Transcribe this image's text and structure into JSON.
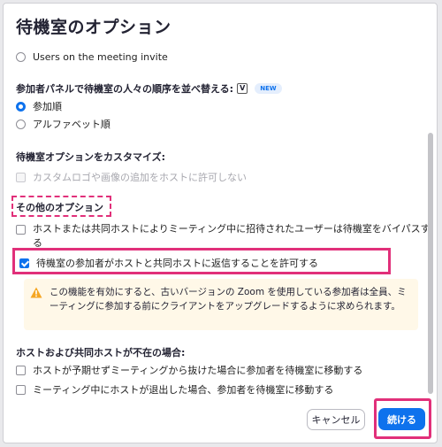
{
  "dialog": {
    "title": "待機室のオプション"
  },
  "who_goes_in": {
    "options": [
      {
        "label": "Users on the meeting invite",
        "checked": false
      }
    ]
  },
  "ordering": {
    "heading": "参加者パネルで待機室の人々の順序を並べ替える:",
    "kbd_icon": "V",
    "new_badge": "NEW",
    "options": [
      {
        "label": "参加順",
        "checked": true
      },
      {
        "label": "アルファベット順",
        "checked": false
      }
    ]
  },
  "customize": {
    "heading": "待機室オプションをカスタマイズ:",
    "options": [
      {
        "label": "カスタムロゴや画像の追加をホストに許可しない",
        "checked": false,
        "disabled": true
      }
    ]
  },
  "other": {
    "heading": "その他のオプション",
    "options": [
      {
        "label": "ホストまたは共同ホストによりミーティング中に招待されたユーザーは待機室をバイパスする",
        "checked": false
      },
      {
        "label": "待機室の参加者がホストと共同ホストに返信することを許可する",
        "checked": true
      }
    ],
    "warning": "この機能を有効にすると、古いバージョンの Zoom を使用している参加者は全員、ミーティングに参加する前にクライアントをアップグレードするように求められます。"
  },
  "absent": {
    "heading": "ホストおよび共同ホストが不在の場合:",
    "options": [
      {
        "label": "ホストが予期せずミーティングから抜けた場合に参加者を待機室に移動する",
        "checked": false
      },
      {
        "label": "ミーティング中にホストが退出した場合、参加者を待機室に移動する",
        "checked": false
      }
    ]
  },
  "footer": {
    "cancel_label": "キャンセル",
    "continue_label": "続ける"
  },
  "colors": {
    "accent": "#0e72ed",
    "annotation": "#e1307a",
    "warning_bg": "#fff8e8",
    "warning_icon": "#f5a623"
  },
  "icons": {
    "warning": "warning-triangle-icon"
  }
}
